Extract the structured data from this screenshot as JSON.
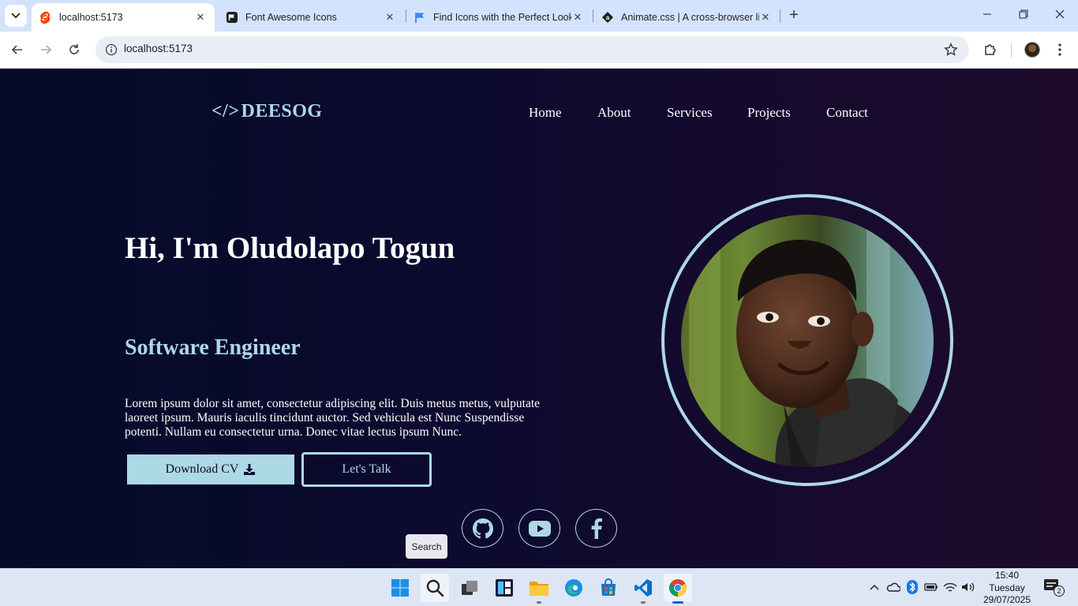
{
  "browser": {
    "tabs": [
      {
        "title": "localhost:5173",
        "favicon": "svelte-icon",
        "active": true
      },
      {
        "title": "Font Awesome Icons",
        "favicon": "flag-icon",
        "active": false
      },
      {
        "title": "Find Icons with the Perfect Look",
        "favicon": "flag-blue-icon",
        "active": false
      },
      {
        "title": "Animate.css | A cross-browser library",
        "favicon": "animate-icon",
        "active": false
      }
    ],
    "url": "localhost:5173"
  },
  "page": {
    "logo_text": "DEESOG",
    "logo_icon": "</>",
    "nav": [
      "Home",
      "About",
      "Services",
      "Projects",
      "Contact"
    ],
    "hero_title": "Hi, I'm Oludolapo Togun",
    "hero_role": "Software Engineer",
    "hero_description": "Lorem ipsum dolor sit amet, consectetur adipiscing elit. Duis metus metus, vulputate laoreet ipsum. Mauris iaculis tincidunt auctor. Sed vehicula est Nunc Suspendisse potenti. Nullam eu consectetur urna. Donec vitae lectus ipsum Nunc.",
    "download_button": "Download CV",
    "talk_button": "Let's Talk",
    "social": [
      "github-icon",
      "youtube-icon",
      "facebook-icon"
    ],
    "accent_color": "#add8e6"
  },
  "tooltip": "Search",
  "taskbar": {
    "time": "15:40",
    "day": "Tuesday",
    "date": "29/07/2025",
    "notification_count": "2"
  }
}
